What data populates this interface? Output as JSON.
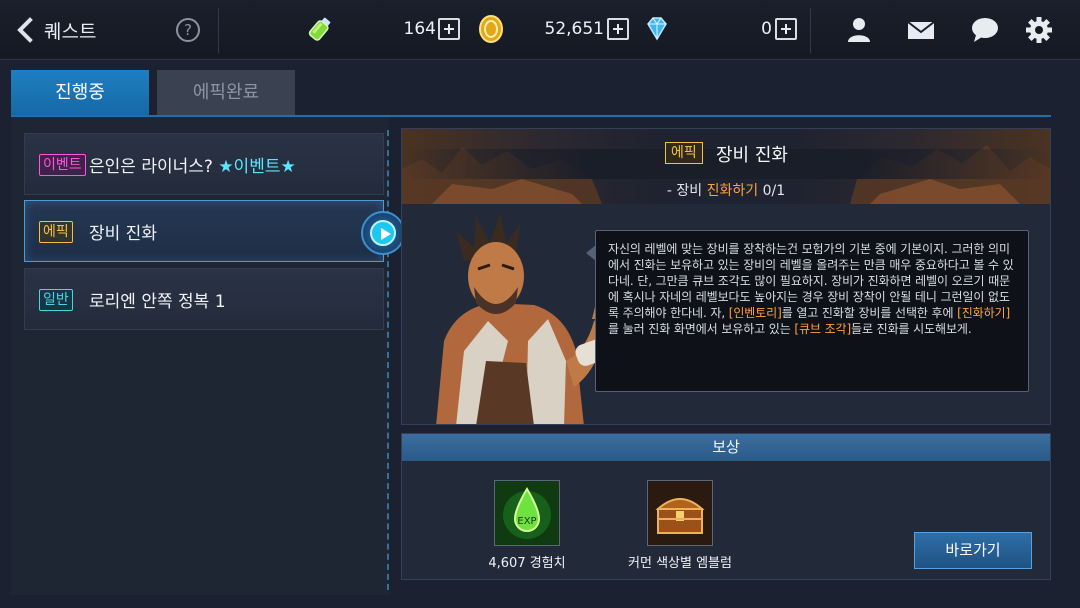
{
  "header": {
    "title": "퀘스트",
    "help_label": "?",
    "resources": [
      {
        "icon": "energy-potion-icon",
        "value": "164"
      },
      {
        "icon": "gold-coin-icon",
        "value": "52,651"
      },
      {
        "icon": "diamond-icon",
        "value": "0"
      }
    ]
  },
  "tabs": [
    {
      "label": "진행중",
      "active": true
    },
    {
      "label": "에픽완료",
      "active": false
    }
  ],
  "quests": [
    {
      "badge": "이벤트",
      "type": "event",
      "text": "은인은 라이너스? ",
      "highlight": "★이벤트★"
    },
    {
      "badge": "에픽",
      "type": "epic",
      "text": "장비 진화",
      "selected": true
    },
    {
      "badge": "일반",
      "type": "normal",
      "text": "로리엔 안쪽 정복 1"
    }
  ],
  "detail": {
    "badge": "에픽",
    "title": "장비 진화",
    "objective_prefix": "- 장비 ",
    "objective_highlight": "진화하기",
    "objective_suffix": " 0/1",
    "dialog": [
      {
        "t": "자신의 레벨에 맞는 장비를 장착하는건 모험가의 기본 중에 기본이지. 그러한 의미에서 진화는 보유하고 있는 장비의 레벨을 올려주는 만큼 매우 중요하다고 볼 수 있다네. 단, 그만큼 큐브 조각도 많이 필요하지. 장비가 진화하면 레벨이 오르기 때문에 혹시나 자네의 레벨보다도 높아지는 경우 장비 장착이 안될 테니 그런일이 없도록 주의해야 한다네. 자, "
      },
      {
        "t": "[인벤토리]",
        "hl": true
      },
      {
        "t": "를 열고 진화할 장비를 선택한 후에 "
      },
      {
        "t": "[진화하기]",
        "hl": true
      },
      {
        "t": "를 눌러 진화 화면에서 보유하고 있는 "
      },
      {
        "t": "[큐브 조각]",
        "hl": true
      },
      {
        "t": "들로 진화를 시도해보게."
      }
    ]
  },
  "reward": {
    "header": "보상",
    "items": [
      {
        "icon": "experience-potion-icon",
        "label": "4,607 경험치"
      },
      {
        "icon": "treasure-chest-icon",
        "label": "커먼 색상별 엠블럼"
      }
    ],
    "go_button": "바로가기"
  },
  "colors": {
    "accent_blue": "#1f7ec2",
    "event_pink": "#ff53e6",
    "epic_gold": "#f3c13c",
    "normal_cyan": "#48d6e6",
    "highlight_orange": "#ffa23c"
  }
}
